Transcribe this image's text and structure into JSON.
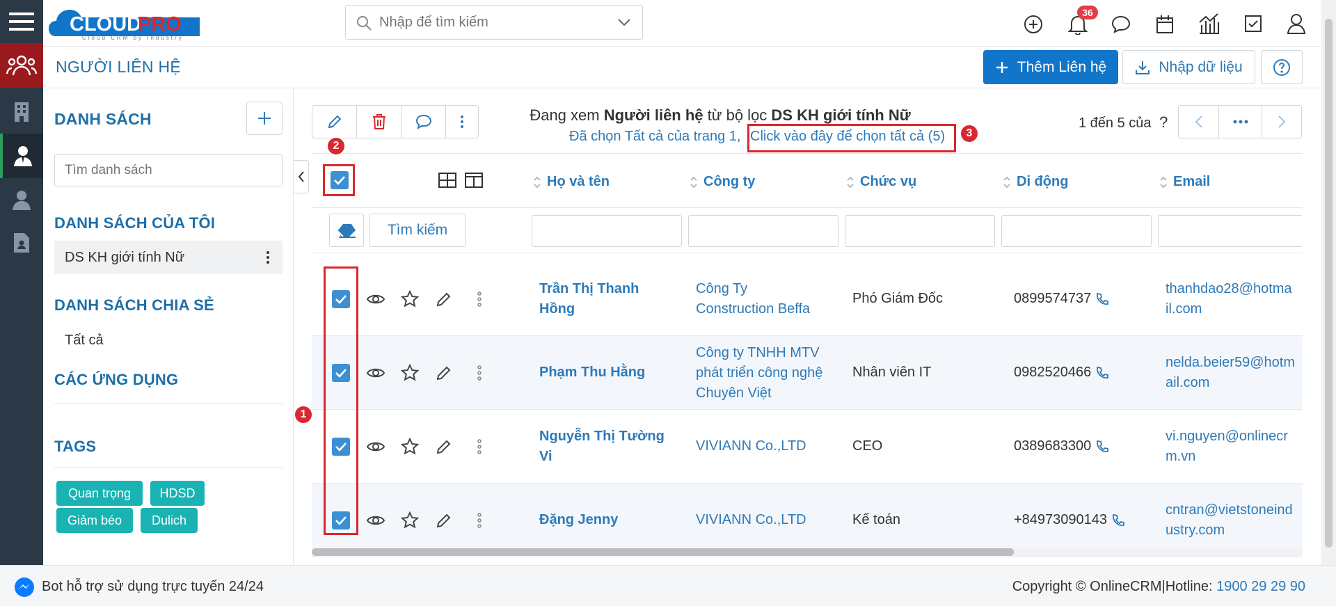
{
  "brand": {
    "logo_text": "CLOUDPRO",
    "logo_sub": "Cloud CRM by Industry",
    "primary": "#1175c9",
    "nav_dark": "#2b3947",
    "rail_red": "#9b1a1e",
    "tag_teal": "#1ab3b3",
    "annotation_red": "#d9282f"
  },
  "topbar": {
    "search_placeholder": "Nhập để tìm kiếm",
    "notification_count": "36"
  },
  "header": {
    "page_title": "NGƯỜI LIÊN HỆ",
    "add_contact_label": "Thêm Liên hệ",
    "import_label": "Nhập dữ liệu"
  },
  "sidebar": {
    "lists_heading": "DANH SÁCH",
    "search_placeholder": "Tìm danh sách",
    "my_lists_heading": "DANH SÁCH CỦA TÔI",
    "my_lists": [
      {
        "label": "DS KH giới tính Nữ"
      }
    ],
    "shared_heading": "DANH SÁCH CHIA SẺ",
    "shared_lists": [
      {
        "label": "Tất cả"
      }
    ],
    "apps_heading": "CÁC ỨNG DỤNG",
    "tags_heading": "TAGS",
    "tags": [
      "Quan trọng",
      "HDSD",
      "Giảm béo",
      "Dulich"
    ]
  },
  "viewing": {
    "prefix": "Đang xem ",
    "module": "Người liên hệ",
    "middle": " từ bộ lọc ",
    "filter": "DS KH giới tính Nữ",
    "selected_text": "Đã chọn Tất cả của trang 1,",
    "select_all_link": "Click vào đây để chọn tất cả (5)"
  },
  "pagination": {
    "range": "1 đến 5 của",
    "unknown_total": "?"
  },
  "grid": {
    "columns": [
      "Họ và tên",
      "Công ty",
      "Chức vụ",
      "Di động",
      "Email"
    ],
    "search_button": "Tìm kiếm",
    "rows": [
      {
        "name_line1": "Trần Thị Thanh",
        "name_line2": "Hồng",
        "company_lines": [
          "Công Ty",
          "Construction Beffa"
        ],
        "title": "Phó Giám Đốc",
        "mobile": "0899574737",
        "email_lines": [
          "thanhdao28@hotma",
          "il.com"
        ]
      },
      {
        "name_line1": "Phạm Thu Hằng",
        "name_line2": "",
        "company_lines": [
          "Công ty TNHH MTV",
          "phát triển công nghệ",
          "Chuyên Việt"
        ],
        "title": "Nhân viên IT",
        "mobile": "0982520466",
        "email_lines": [
          "nelda.beier59@hotm",
          "ail.com"
        ]
      },
      {
        "name_line1": "Nguyễn Thị Tường",
        "name_line2": "Vi",
        "company_lines": [
          "VIVIANN Co.,LTD"
        ],
        "title": "CEO",
        "mobile": "0389683300",
        "email_lines": [
          "vi.nguyen@onlinecr",
          "m.vn"
        ]
      },
      {
        "name_line1": "Đặng Jenny",
        "name_line2": "",
        "company_lines": [
          "VIVIANN Co.,LTD"
        ],
        "title": "Kế toán",
        "mobile": "+84973090143",
        "email_lines": [
          "cntran@vietstoneind",
          "ustry.com"
        ]
      }
    ]
  },
  "annotations": [
    "1",
    "2",
    "3"
  ],
  "footer": {
    "bot_text": "Bot hỗ trợ sử dụng trực tuyến 24/24",
    "copyright": "Copyright © OnlineCRM",
    "separator": "|",
    "hotline_label": "Hotline: ",
    "hotline_number": "1900 29 29 90"
  }
}
